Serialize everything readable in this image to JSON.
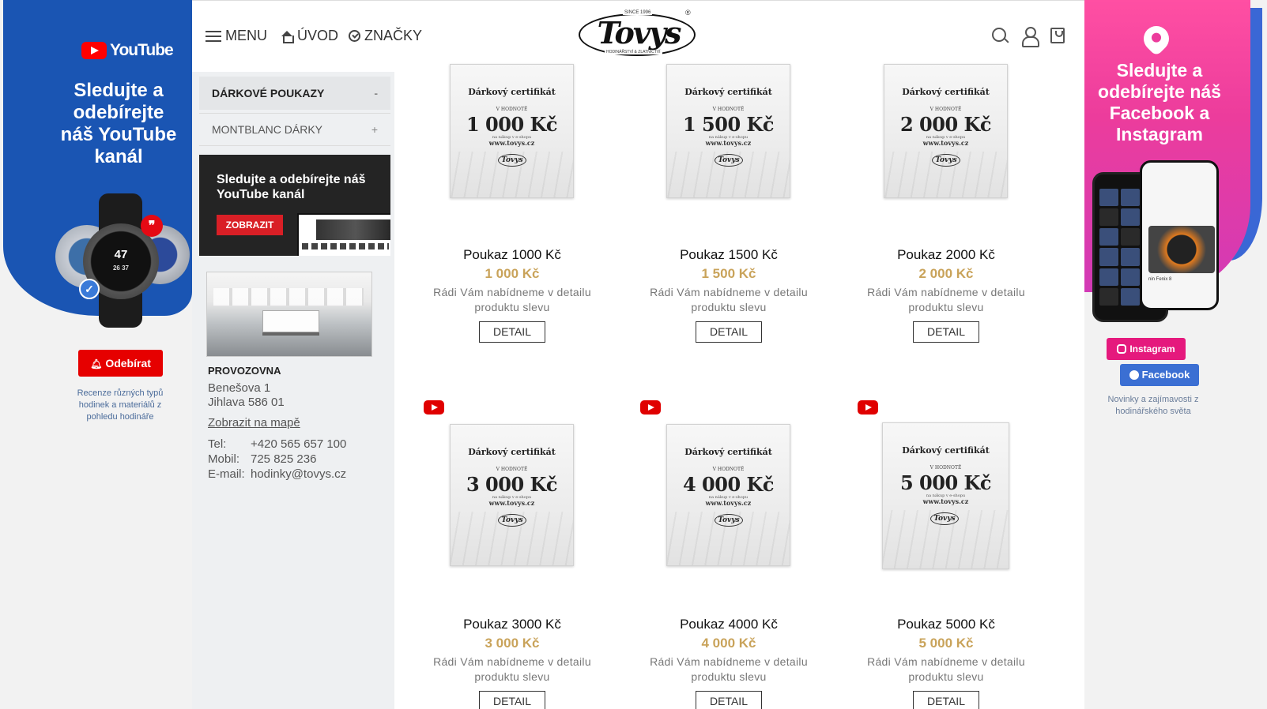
{
  "left_banner": {
    "yt_word": "YouTube",
    "headline": "Sledujte a odebírejte náš YouTube kanál",
    "watch_face_main": "47",
    "watch_face_sub": "26 37",
    "subscribe_label": "Odebírat",
    "caption": "Recenze různých typů hodinek a materiálů z pohledu hodináře",
    "accent_color": "#1a55b3"
  },
  "header": {
    "menu_label": "MENU",
    "home_label": "ÚVOD",
    "brands_label": "ZNAČKY",
    "logo_word": "Tovys",
    "logo_since": "SINCE 1996",
    "logo_tagline": "HODINÁŘSTVÍ & ZLATNICTVÍ",
    "logo_reg": "®"
  },
  "sidebar": {
    "categories": [
      {
        "label": "DÁRKOVÉ POUKAZY",
        "sign": "-"
      },
      {
        "label": "MONTBLANC DÁRKY",
        "sign": "+"
      }
    ],
    "yt_promo": {
      "title": "Sledujte a odebírejte náš YouTube kanál",
      "button": "ZOBRAZIT"
    },
    "store": {
      "title": "PROVOZOVNA",
      "street": "Benešova 1",
      "city": "Jihlava 586 01",
      "map_link": "Zobrazit na mapě",
      "tel_label": "Tel:",
      "tel": "+420 565 657 100",
      "mobile_label": "Mobil:",
      "mobile": "725 825 236",
      "email_label": "E-mail:",
      "email": "hodinky@tovys.cz"
    }
  },
  "certificate": {
    "heading": "Dárkový certifikát",
    "sub": "V HODNOTĚ",
    "small": "na nákup v e-shopu",
    "web": "www.tovys.cz",
    "logo": "Tovys"
  },
  "products": [
    {
      "name": "Poukaz 1000 Kč",
      "value": "1 000 Kč",
      "price": "1 000 Kč",
      "desc": "Rádi Vám nabídneme v detailu produktu slevu",
      "detail": "DETAIL"
    },
    {
      "name": "Poukaz 1500 Kč",
      "value": "1 500 Kč",
      "price": "1 500 Kč",
      "desc": "Rádi Vám nabídneme v detailu produktu slevu",
      "detail": "DETAIL"
    },
    {
      "name": "Poukaz 2000 Kč",
      "value": "2 000 Kč",
      "price": "2 000 Kč",
      "desc": "Rádi Vám nabídneme v detailu produktu slevu",
      "detail": "DETAIL"
    },
    {
      "name": "Poukaz 3000 Kč",
      "value": "3 000 Kč",
      "price": "3 000 Kč",
      "desc": "Rádi Vám nabídneme v detailu produktu slevu",
      "detail": "DETAIL"
    },
    {
      "name": "Poukaz 4000 Kč",
      "value": "4 000 Kč",
      "price": "4 000 Kč",
      "desc": "Rádi Vám nabídneme v detailu produktu slevu",
      "detail": "DETAIL"
    },
    {
      "name": "Poukaz 5000 Kč",
      "value": "5 000 Kč",
      "price": "5 000 Kč",
      "desc": "Rádi Vám nabídneme v detailu produktu slevu",
      "detail": "DETAIL"
    }
  ],
  "right_banner": {
    "headline": "Sledujte a odebírejte náš Facebook a Instagram",
    "instagram_label": "Instagram",
    "facebook_label": "Facebook",
    "caption": "Novinky a zajímavosti z hodinářského světa",
    "phone_post_text": "nin Fenix 8",
    "accent_color": "#ec3c9c"
  },
  "colors": {
    "price": "#c9a35a",
    "youtube_red": "#e00000"
  }
}
